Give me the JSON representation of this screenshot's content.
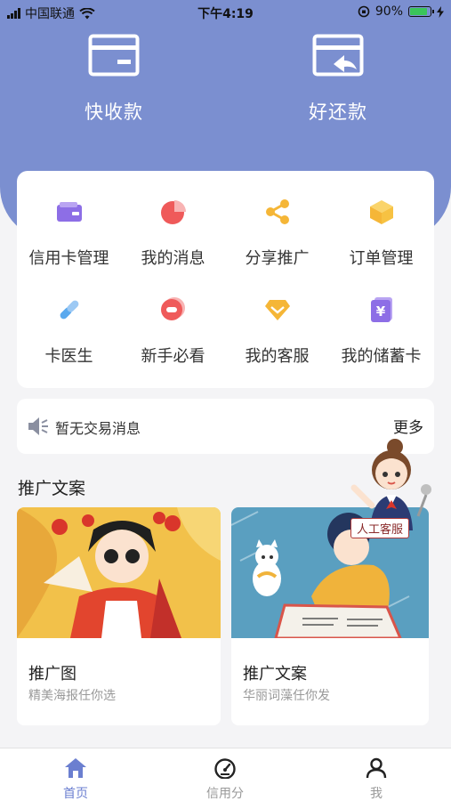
{
  "status_bar": {
    "carrier": "中国联通",
    "time": "下午4:19",
    "battery": "90%",
    "battery_level": 0.9
  },
  "quick_actions": [
    {
      "label": "快收款",
      "icon": "card-icon"
    },
    {
      "label": "好还款",
      "icon": "card-return-icon"
    }
  ],
  "grid": [
    {
      "label": "信用卡管理",
      "icon": "wallet-icon",
      "color": "#8d6ee6"
    },
    {
      "label": "我的消息",
      "icon": "pie-chart-icon",
      "color": "#ef5a5a"
    },
    {
      "label": "分享推广",
      "icon": "share-icon",
      "color": "#f5b637"
    },
    {
      "label": "订单管理",
      "icon": "cube-icon",
      "color": "#f7c242"
    },
    {
      "label": "卡医生",
      "icon": "link-icon",
      "color": "#5aa9ee"
    },
    {
      "label": "新手必看",
      "icon": "helmet-icon",
      "color": "#ef5a5a"
    },
    {
      "label": "我的客服",
      "icon": "diamond-icon",
      "color": "#f5b637"
    },
    {
      "label": "我的储蓄卡",
      "icon": "yuan-card-icon",
      "color": "#8d6ee6"
    }
  ],
  "notice": {
    "message": "暂无交易消息",
    "more": "更多"
  },
  "section_title": "推广文案",
  "mascot_label": "人工客服",
  "promos": [
    {
      "title": "推广图",
      "subtitle": "精美海报任你选"
    },
    {
      "title": "推广文案",
      "subtitle": "华丽词藻任你发"
    }
  ],
  "tabbar": [
    {
      "label": "首页",
      "icon": "home-icon",
      "active": true
    },
    {
      "label": "信用分",
      "icon": "gauge-icon",
      "active": false
    },
    {
      "label": "我",
      "icon": "user-icon",
      "active": false
    }
  ],
  "colors": {
    "header": "#7b8fd0",
    "active_tab": "#6b7fd0"
  }
}
